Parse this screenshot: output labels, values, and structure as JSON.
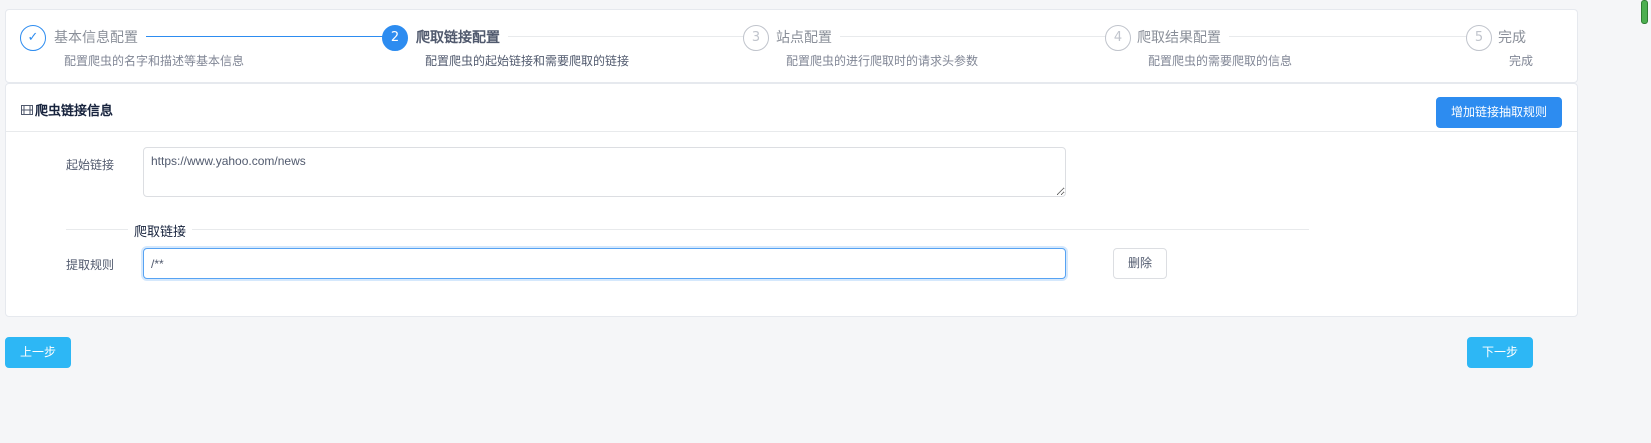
{
  "steps": [
    {
      "number": "✓",
      "title": "基本信息配置",
      "desc": "配置爬虫的名字和描述等基本信息",
      "state": "done"
    },
    {
      "number": "2",
      "title": "爬取链接配置",
      "desc": "配置爬虫的起始链接和需要爬取的链接",
      "state": "active"
    },
    {
      "number": "3",
      "title": "站点配置",
      "desc": "配置爬虫的进行爬取时的请求头参数",
      "state": "pending"
    },
    {
      "number": "4",
      "title": "爬取结果配置",
      "desc": "配置爬虫的需要爬取的信息",
      "state": "pending"
    },
    {
      "number": "5",
      "title": "完成",
      "desc": "完成",
      "state": "pending"
    }
  ],
  "card": {
    "title": "爬虫链接信息",
    "add_rule_button": "增加链接抽取规则",
    "start_url_label": "起始链接",
    "start_url_value": "https://www.yahoo.com/news",
    "crawl_section_title": "爬取链接",
    "extract_rule_label": "提取规则",
    "extract_rule_value": "/**",
    "delete_button": "删除"
  },
  "nav": {
    "prev_button": "上一步",
    "next_button": "下一步"
  },
  "colors": {
    "primary": "#2d8cf0",
    "info": "#2db7f5",
    "border": "#dcdee2",
    "background": "#f5f6f8"
  }
}
